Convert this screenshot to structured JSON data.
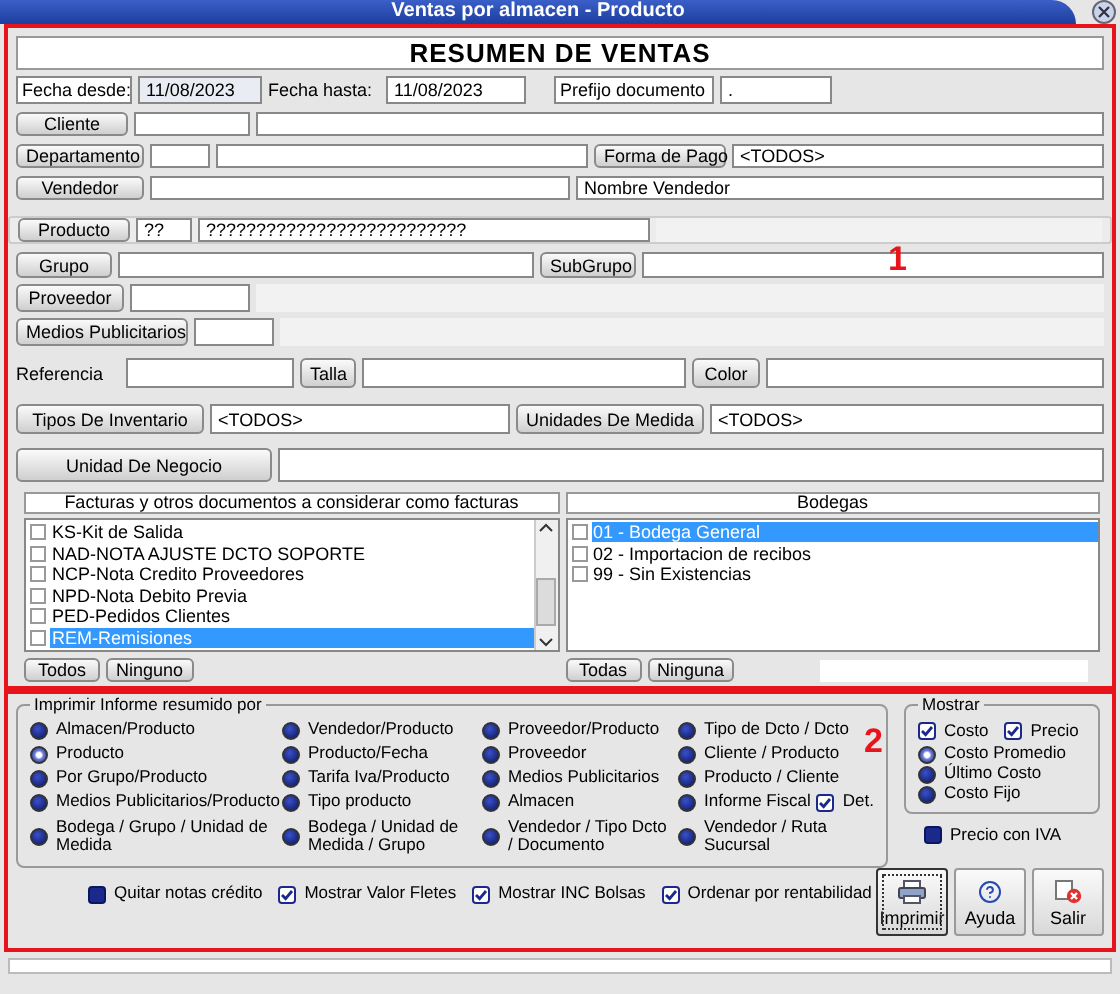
{
  "window": {
    "title": "Ventas por almacen - Producto"
  },
  "header": "RESUMEN DE VENTAS",
  "dates": {
    "from_label": "Fecha desde:",
    "from": "11/08/2023",
    "to_label": "Fecha hasta:",
    "to": "11/08/2023",
    "prefix_label": "Prefijo documento",
    "prefix": "."
  },
  "filter_rows": [
    {
      "items": [
        {
          "kind": "button",
          "text": "Cliente"
        },
        {
          "kind": "field"
        },
        {
          "kind": "field"
        }
      ]
    },
    {
      "items": [
        {
          "kind": "button",
          "text": "Departamento"
        },
        {
          "kind": "field"
        },
        {
          "kind": "field"
        },
        {
          "kind": "button",
          "text": "Forma de Pago"
        },
        {
          "kind": "field",
          "value": "<TODOS>"
        }
      ]
    },
    {
      "items": [
        {
          "kind": "button",
          "text": "Vendedor"
        },
        {
          "kind": "field"
        },
        {
          "kind": "field",
          "value": "Nombre Vendedor"
        }
      ]
    },
    {
      "items": [
        {
          "kind": "button",
          "text": "Producto"
        },
        {
          "kind": "field",
          "value": "??"
        },
        {
          "kind": "field",
          "value": "??????????????????????????"
        },
        {
          "kind": "panel"
        }
      ]
    },
    {
      "items": [
        {
          "kind": "button",
          "text": "Grupo"
        },
        {
          "kind": "field"
        },
        {
          "kind": "button",
          "text": "SubGrupo"
        },
        {
          "kind": "field"
        }
      ]
    },
    {
      "items": [
        {
          "kind": "button",
          "text": "Proveedor"
        },
        {
          "kind": "field"
        },
        {
          "kind": "panel"
        }
      ]
    },
    {
      "items": [
        {
          "kind": "button",
          "text": "Medios Publicitarios"
        },
        {
          "kind": "field"
        },
        {
          "kind": "panel"
        }
      ]
    },
    {
      "items": [
        {
          "kind": "label",
          "text": "Referencia"
        },
        {
          "kind": "field"
        },
        {
          "kind": "button",
          "text": "Talla"
        },
        {
          "kind": "field"
        },
        {
          "kind": "button",
          "text": "Color"
        },
        {
          "kind": "field"
        }
      ]
    },
    {
      "items": [
        {
          "kind": "button",
          "text": "Tipos De Inventario"
        },
        {
          "kind": "field",
          "value": "<TODOS>"
        },
        {
          "kind": "button",
          "text": "Unidades De Medida"
        },
        {
          "kind": "field",
          "value": "<TODOS>"
        }
      ]
    },
    {
      "items": [
        {
          "kind": "button",
          "text": "Unidad De Negocio"
        },
        {
          "kind": "field"
        }
      ]
    }
  ],
  "lists": [
    {
      "title": "Facturas y otros documentos a considerar como facturas",
      "scrollable": true,
      "buttons": [
        "Todos",
        "Ninguno"
      ],
      "items": [
        {
          "label": "KS-Kit de Salida",
          "checked": false,
          "selected": false
        },
        {
          "label": "NAD-NOTA AJUSTE DCTO SOPORTE",
          "checked": false,
          "selected": false
        },
        {
          "label": "NCP-Nota Credito Proveedores",
          "checked": false,
          "selected": false
        },
        {
          "label": "NPD-Nota Debito Previa",
          "checked": false,
          "selected": false
        },
        {
          "label": "PED-Pedidos Clientes",
          "checked": false,
          "selected": false
        },
        {
          "label": "REM-Remisiones",
          "checked": false,
          "selected": true
        }
      ]
    },
    {
      "title": "Bodegas",
      "scrollable": false,
      "buttons": [
        "Todas",
        "Ninguna"
      ],
      "items": [
        {
          "label": "01 - Bodega General",
          "checked": false,
          "selected": true
        },
        {
          "label": "02 - Importacion de recibos",
          "checked": false,
          "selected": false
        },
        {
          "label": "99 - Sin Existencias",
          "checked": false,
          "selected": false
        }
      ]
    }
  ],
  "report": {
    "legend": "Imprimir Informe resumido por",
    "options": [
      {
        "label": "Almacen/Producto",
        "selected": false
      },
      {
        "label": "Producto",
        "selected": true
      },
      {
        "label": "Por Grupo/Producto",
        "selected": false
      },
      {
        "label": "Medios Publicitarios/Producto",
        "selected": false
      },
      {
        "label": "Bodega / Grupo / Unidad de Medida",
        "selected": false
      },
      {
        "label": "Vendedor/Producto",
        "selected": false
      },
      {
        "label": "Producto/Fecha",
        "selected": false
      },
      {
        "label": "Tarifa Iva/Producto",
        "selected": false
      },
      {
        "label": "Tipo producto",
        "selected": false
      },
      {
        "label": "Bodega / Unidad de Medida / Grupo",
        "selected": false
      },
      {
        "label": "Proveedor/Producto",
        "selected": false
      },
      {
        "label": "Proveedor",
        "selected": false
      },
      {
        "label": "Medios Publicitarios",
        "selected": false
      },
      {
        "label": "Almacen",
        "selected": false
      },
      {
        "label": "Vendedor / Tipo Dcto / Documento",
        "selected": false
      },
      {
        "label": "Tipo de Dcto / Dcto",
        "selected": false
      },
      {
        "label": "Cliente / Producto",
        "selected": false
      },
      {
        "label": "Producto / Cliente",
        "selected": false
      },
      {
        "label": "Informe Fiscal",
        "selected": false
      },
      {
        "label": "Vendedor / Ruta Sucursal",
        "selected": false
      }
    ],
    "detail": {
      "label": "Det.",
      "checked": true
    }
  },
  "show": {
    "legend": "Mostrar",
    "checks": [
      {
        "label": "Costo",
        "checked": true
      },
      {
        "label": "Precio",
        "checked": true
      }
    ],
    "costs": [
      {
        "label": "Costo Promedio",
        "selected": true
      },
      {
        "label": "Último Costo",
        "selected": false
      },
      {
        "label": "Costo Fijo",
        "selected": false
      }
    ],
    "price_with_tax": {
      "label": "Precio con IVA",
      "checked": false
    }
  },
  "options": [
    {
      "label": "Quitar notas crédito",
      "checked": false
    },
    {
      "label": "Mostrar Valor Fletes",
      "checked": true
    },
    {
      "label": "Mostrar INC Bolsas",
      "checked": true
    },
    {
      "label": "Ordenar por rentabilidad",
      "checked": true
    }
  ],
  "actions": [
    {
      "kind": "print",
      "label": "Imprimir"
    },
    {
      "kind": "help",
      "label": "Ayuda"
    },
    {
      "kind": "exit",
      "label": "Salir"
    }
  ],
  "annotations": [
    {
      "label": "1"
    },
    {
      "label": "2"
    }
  ]
}
